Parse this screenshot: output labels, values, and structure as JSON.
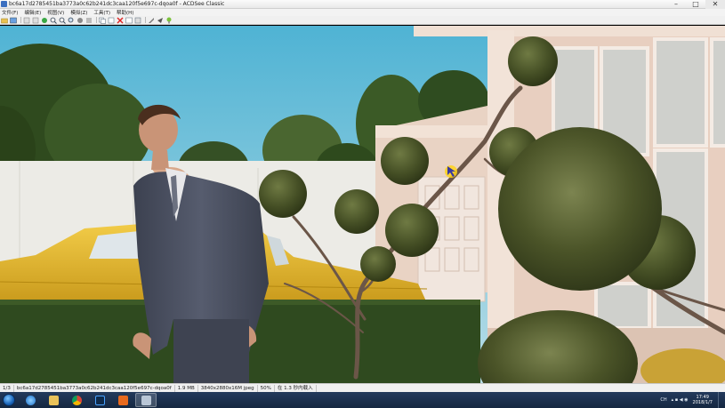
{
  "window": {
    "title": "bc6a17d2785451ba3773a0c62b241dc3caa120f5e697c-dqoa0f - ACDSee Classic",
    "minimize": "–",
    "maximize": "□",
    "close": "✕"
  },
  "menu": {
    "items": [
      "文件(F)",
      "编辑(E)",
      "视图(V)",
      "模拟(Z)",
      "工具(T)",
      "帮助(H)"
    ]
  },
  "toolbar": {
    "buttons": [
      "open-folder-icon",
      "browse-icon",
      "prev-icon",
      "next-icon",
      "zoom-in-icon",
      "zoom-out-icon",
      "zoom-fit-icon",
      "full-screen-icon",
      "copy-icon",
      "move-icon",
      "delete-icon",
      "rotate-icon",
      "properties-icon",
      "info-icon",
      "help-icon"
    ]
  },
  "status": {
    "index": "1/3",
    "filename": "bc6a17d2785451ba3773a0c62b241dc3caa120f5e697c-dqoa0f",
    "filesize": "1.9 MB",
    "dimensions": "3840x2880x16M jpeg",
    "zoom": "50%",
    "load_time": "在 1.3 秒内载入"
  },
  "taskbar": {
    "clock_time": "17:49",
    "clock_date": "2018/1/7",
    "tray_label": "CH"
  },
  "colors": {
    "sky": "#57b7d6",
    "house_wall": "#eed7c8",
    "car": "#e0b52a",
    "hedge": "#2f4a1f",
    "suit": "#4a4f60",
    "taskbar": "#1b3150"
  }
}
